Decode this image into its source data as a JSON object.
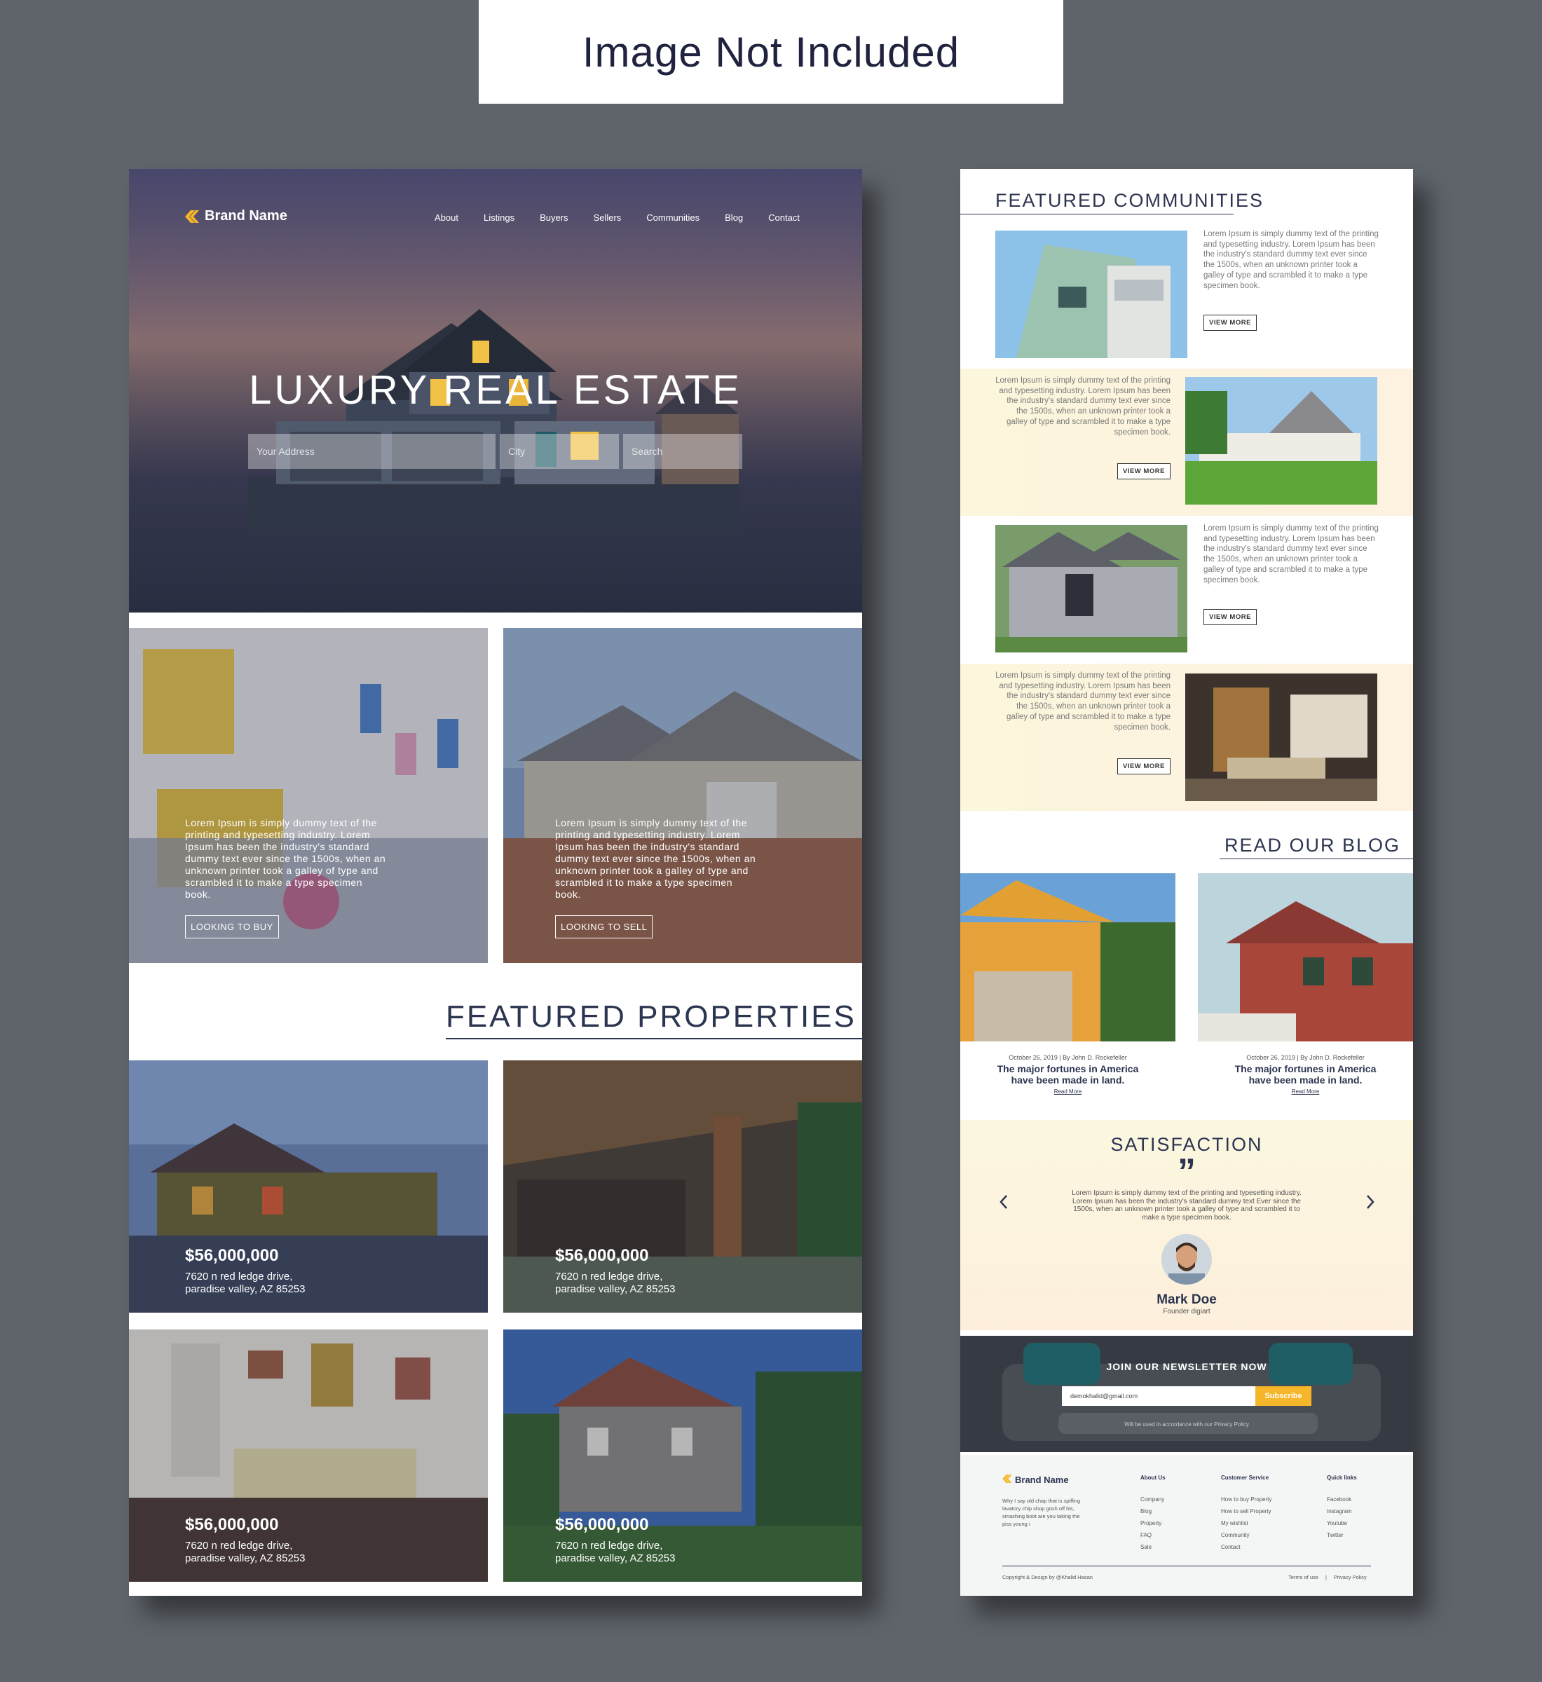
{
  "banner": {
    "text": "Image Not Included"
  },
  "left": {
    "brand": "Brand Name",
    "nav": [
      "About",
      "Listings",
      "Buyers",
      "Sellers",
      "Communities",
      "Blog",
      "Contact"
    ],
    "hero_title": "LUXURY REAL ESTATE",
    "search": {
      "address_placeholder": "Your Address",
      "city_placeholder": "City",
      "search_placeholder": "Search"
    },
    "cards": [
      {
        "text": "Lorem Ipsum is simply dummy text of the printing and typesetting industry. Lorem Ipsum has been the industry's standard dummy text ever since the 1500s, when an unknown printer took a galley of type and scrambled it to make a type specimen book.",
        "button": "LOOKING TO BUY"
      },
      {
        "text": "Lorem Ipsum is simply dummy text of the printing and typesetting industry. Lorem Ipsum has been the industry's standard dummy text ever since the 1500s, when an unknown printer took a galley of type and scrambled it to make a type specimen book.",
        "button": "LOOKING TO SELL"
      }
    ],
    "featured_title": "FEATURED PROPERTIES",
    "properties": [
      {
        "price": "$56,000,000",
        "address1": "7620 n red ledge drive,",
        "address2": "paradise valley, AZ 85253"
      },
      {
        "price": "$56,000,000",
        "address1": "7620 n red ledge drive,",
        "address2": "paradise valley, AZ 85253"
      },
      {
        "price": "$56,000,000",
        "address1": "7620 n red ledge drive,",
        "address2": "paradise valley, AZ 85253"
      },
      {
        "price": "$56,000,000",
        "address1": "7620 n red ledge drive,",
        "address2": "paradise valley, AZ 85253"
      }
    ]
  },
  "right": {
    "communities_title": "FEATURED COMMUNITIES",
    "communities": [
      {
        "text": "Lorem Ipsum is simply dummy text of the printing and typesetting industry. Lorem Ipsum has been the industry's standard dummy text ever since the 1500s, when an unknown printer took a galley of type and scrambled it to make a type specimen book.",
        "button": "VIEW MORE"
      },
      {
        "text": "Lorem Ipsum is simply dummy text of the printing and typesetting industry. Lorem Ipsum has been the industry's standard dummy text ever since the 1500s, when an unknown printer took a galley of type and scrambled it to make a type specimen book.",
        "button": "VIEW MORE"
      },
      {
        "text": "Lorem Ipsum is simply dummy text of the printing and typesetting industry. Lorem Ipsum has been the industry's standard dummy text ever since the 1500s, when an unknown printer took a galley of type and scrambled it to make a type specimen book.",
        "button": "VIEW MORE"
      },
      {
        "text": "Lorem Ipsum is simply dummy text of the printing and typesetting industry. Lorem Ipsum has been the industry's standard dummy text ever since the 1500s, when an unknown printer took a galley of type and scrambled it to make a type specimen book.",
        "button": "VIEW MORE"
      }
    ],
    "blog_title": "READ OUR BLOG",
    "posts": [
      {
        "meta": "October 26, 2019 | By John D. Rockefeller",
        "title1": "The major fortunes in America",
        "title2": "have been made in land.",
        "link": "Read More"
      },
      {
        "meta": "October 26, 2019 | By John D. Rockefeller",
        "title1": "The major fortunes in America",
        "title2": "have been made in land.",
        "link": "Read More"
      }
    ],
    "satisfaction": {
      "title": "SATISFACTION",
      "quote_mark": "”",
      "text": "Lorem Ipsum is simply dummy text of the printing and typesetting industry. Lorem Ipsum has been the industry's standard dummy text Ever since the 1500s, when an unknown printer took a galley of type and scrambled it to make a type specimen book.",
      "name": "Mark Doe",
      "role": "Founder digiart"
    },
    "newsletter": {
      "title": "JOIN OUR NEWSLETTER NOW",
      "email_value": "demokhalid@gmail.com",
      "button": "Subscribe",
      "note": "Will be used in accordance with our Privacy Policy"
    },
    "footer": {
      "brand": "Brand Name",
      "about": "Why I say old chap that is spiffing lavatory chip shop gosh off his, smashing boot are you taking the piss young i",
      "columns": [
        {
          "heading": "About Us",
          "links": [
            "Company",
            "Blog",
            "Property",
            "FAQ",
            "Sale"
          ]
        },
        {
          "heading": "Customer Service",
          "links": [
            "How to buy Property",
            "How to sell Property",
            "My wishlist",
            "Community",
            "Contact"
          ]
        },
        {
          "heading": "Quick links",
          "links": [
            "Facebook",
            "Instagram",
            "Youtube",
            "Twitter"
          ]
        }
      ],
      "copyright": "Copyright & Design by @Khalid Hasan",
      "terms": "Terms of use",
      "separator": "|",
      "privacy": "Privacy Policy"
    }
  },
  "colors": {
    "background": "#5f646b",
    "accent": "#f5b629",
    "navy": "#2c3550",
    "cream": "#fbf6dc"
  }
}
